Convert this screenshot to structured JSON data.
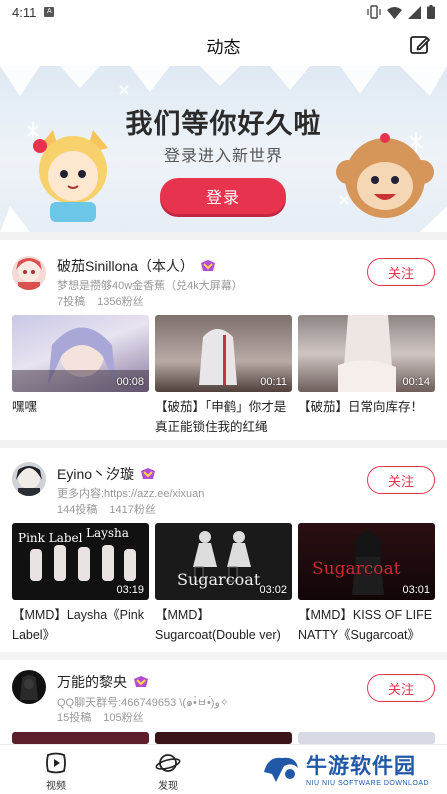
{
  "status": {
    "time": "4:11",
    "sim_label": "A"
  },
  "header": {
    "title": "动态"
  },
  "banner": {
    "headline": "我们等你好久啦",
    "subline": "登录进入新世界",
    "login_label": "登录"
  },
  "icons": {
    "edit": "edit-icon",
    "vibrate": "vibrate-icon",
    "wifi": "wifi-icon",
    "signal": "signal-icon",
    "battery": "battery-icon",
    "video_tab": "video-play-icon",
    "discover_tab": "planet-icon"
  },
  "colors": {
    "accent": "#e8334f",
    "badge": "#b34bd6",
    "watermark": "#2159a8"
  },
  "users": [
    {
      "name": "破茄Sinillona（本人）",
      "sign": "梦想是攒够40w金香蕉（兑4k大屏幕）",
      "posts": "7投稿",
      "fans": "1356粉丝",
      "follow_label": "关注",
      "videos": [
        {
          "duration": "00:08",
          "title": "嘿嘿"
        },
        {
          "duration": "00:11",
          "title": "【破茄】「申鹤」你才是真正能锁住我的红绳"
        },
        {
          "duration": "00:14",
          "title": "【破茄】日常向库存！"
        }
      ]
    },
    {
      "name": "Eyino丶汐璇",
      "sign": "更多内容:https://azz.ee/xixuan",
      "posts": "144投稿",
      "fans": "1417粉丝",
      "follow_label": "关注",
      "videos": [
        {
          "duration": "03:19",
          "title": "【MMD】Laysha《Pink Label》",
          "overlay_a": "Pink Label",
          "overlay_b": "Laysha"
        },
        {
          "duration": "03:02",
          "title": "【MMD】Sugarcoat(Double ver)",
          "overlay_a": "Sugarcoat"
        },
        {
          "duration": "03:01",
          "title": "【MMD】KISS OF LIFE NATTY《Sugarcoat》",
          "overlay_a": "Sugarcoat"
        }
      ]
    },
    {
      "name": "万能的黎央",
      "sign": "QQ聊天群号:466749653 \\(๑•̀ㅂ•́)و✧",
      "posts": "15投稿",
      "fans": "105粉丝",
      "follow_label": "关注"
    }
  ],
  "tabbar": {
    "video_label": "视频",
    "discover_label": "发现"
  },
  "watermark": {
    "title": "牛游软件园",
    "subtitle": "NIU NIU SOFTWARE DOWNLOAD"
  }
}
